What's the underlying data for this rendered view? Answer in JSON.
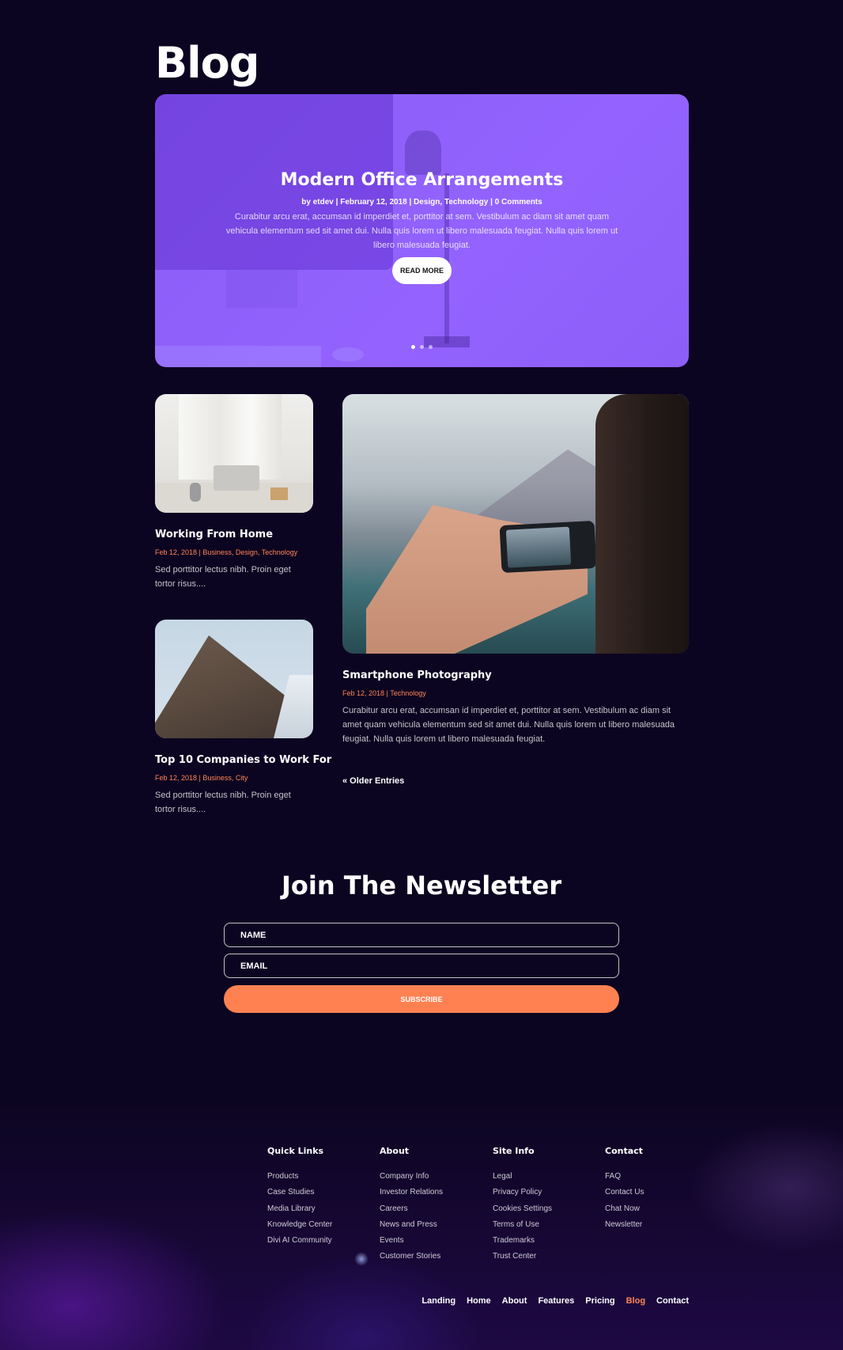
{
  "page": {
    "title": "Blog"
  },
  "hero": {
    "title": "Modern Office Arrangements",
    "meta": "by etdev | February 12, 2018 | Design, Technology | 0 Comments",
    "excerpt": "Curabitur arcu erat, accumsan id imperdiet et, porttitor at sem. Vestibulum ac diam sit amet quam vehicula elementum sed sit amet dui. Nulla quis lorem ut libero malesuada feugiat. Nulla quis lorem ut libero malesuada feugiat.",
    "button_label": "READ MORE",
    "slides_total": 3,
    "active_slide": 1
  },
  "posts": [
    {
      "title": "Working From Home",
      "meta": "Feb 12, 2018 | Business, Design, Technology",
      "excerpt": "Sed porttitor lectus nibh. Proin eget tortor risus...."
    },
    {
      "title": "Smartphone Photography",
      "meta": "Feb 12, 2018 | Technology",
      "excerpt": "Curabitur arcu erat, accumsan id imperdiet et, porttitor at sem. Vestibulum ac diam sit amet quam vehicula elementum sed sit amet dui. Nulla quis lorem ut libero malesuada feugiat. Nulla quis lorem ut libero malesuada feugiat."
    },
    {
      "title": "Top 10 Companies to Work For",
      "meta": "Feb 12, 2018 | Business, City",
      "excerpt": "Sed porttitor lectus nibh. Proin eget tortor risus...."
    }
  ],
  "pagination": {
    "older_label": "« Older Entries"
  },
  "newsletter": {
    "title": "Join The Newsletter",
    "name_placeholder": "NAME",
    "email_placeholder": "EMAIL",
    "button_label": "SUBSCRIBE"
  },
  "footer": {
    "columns": [
      {
        "heading": "Quick Links",
        "links": [
          "Products",
          "Case Studies",
          "Media Library",
          "Knowledge Center",
          "Divi AI Community"
        ]
      },
      {
        "heading": "About",
        "links": [
          "Company Info",
          "Investor Relations",
          "Careers",
          "News and Press",
          "Events",
          "Customer Stories"
        ]
      },
      {
        "heading": "Site Info",
        "links": [
          "Legal",
          "Privacy Policy",
          "Cookies Settings",
          "Terms of Use",
          "Trademarks",
          "Trust Center"
        ]
      },
      {
        "heading": "Contact",
        "links": [
          "FAQ",
          "Contact Us",
          "Chat Now",
          "Newsletter"
        ]
      }
    ],
    "nav": [
      "Landing",
      "Home",
      "About",
      "Features",
      "Pricing",
      "Blog",
      "Contact"
    ],
    "active_nav": "Blog"
  },
  "colors": {
    "background": "#0c0521",
    "hero_purple": "#9463ff",
    "accent_orange": "#ff8152",
    "text": "#ffffff"
  }
}
